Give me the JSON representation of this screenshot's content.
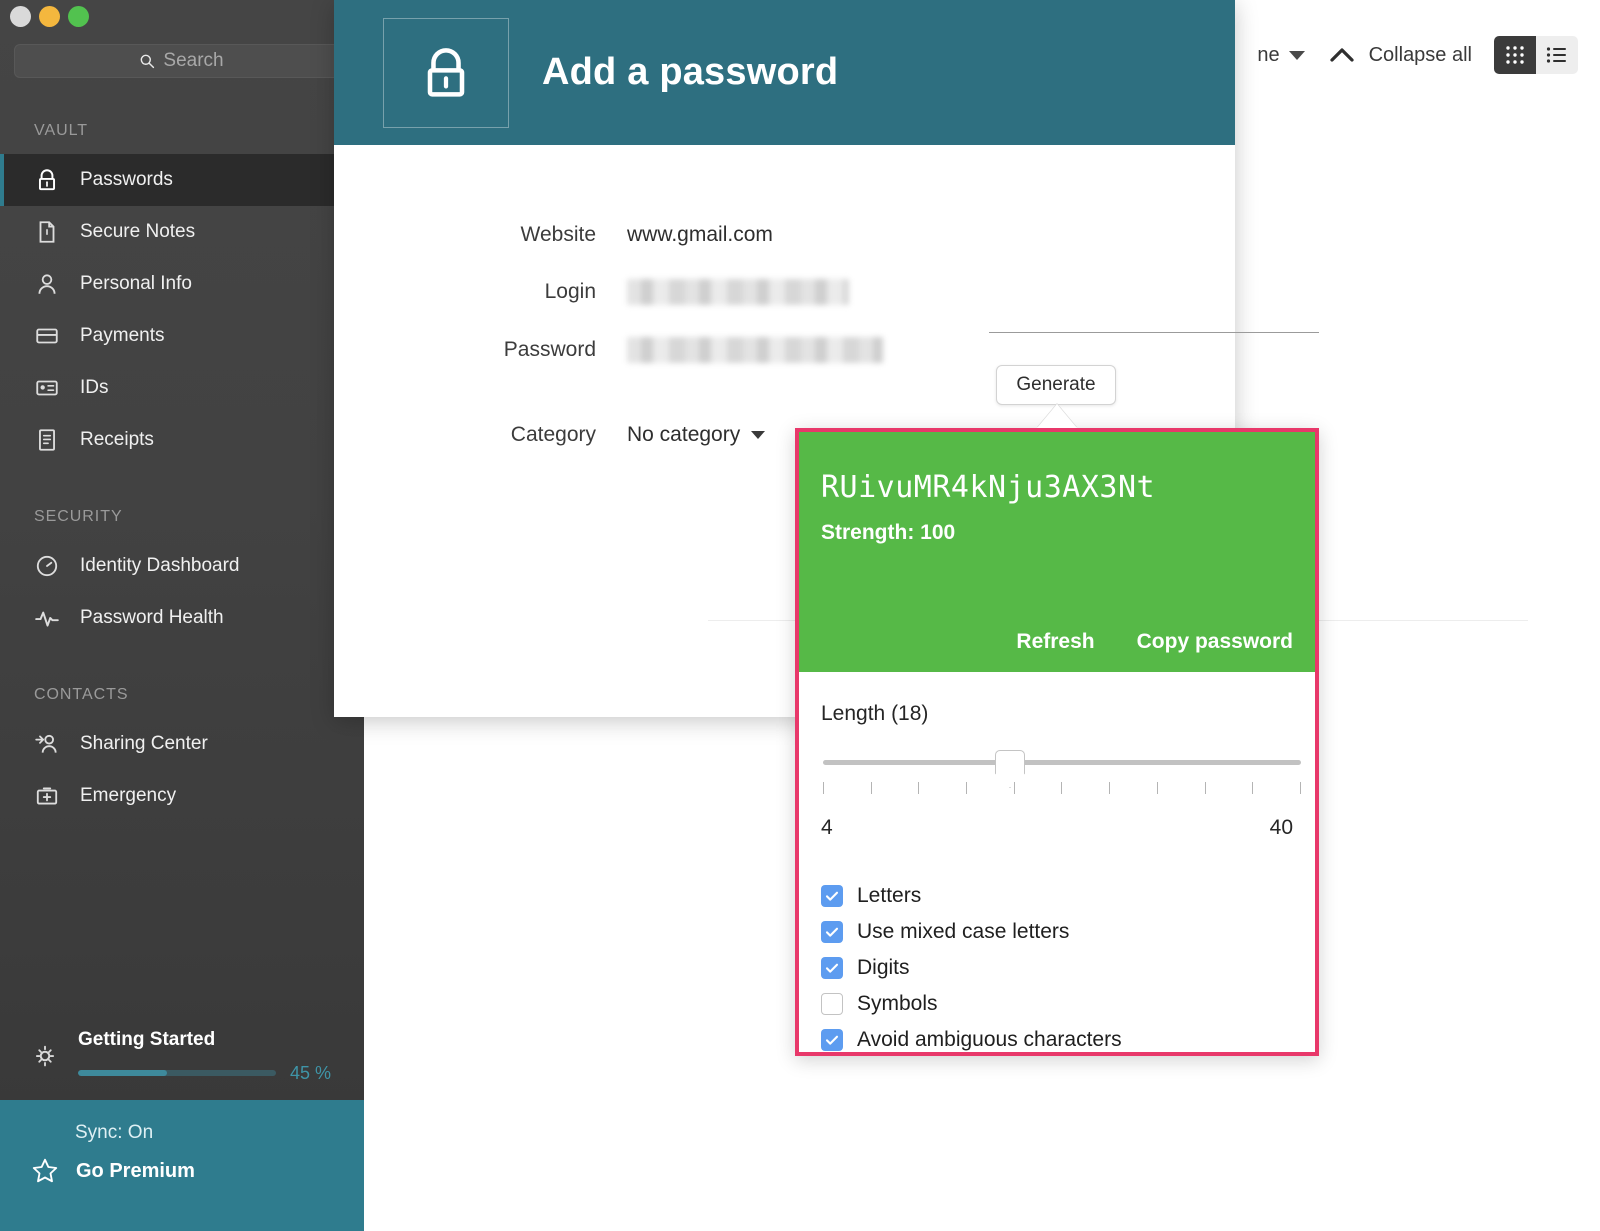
{
  "window": {
    "traffic_lights": [
      "close",
      "minimize",
      "zoom"
    ]
  },
  "search": {
    "placeholder": "Search",
    "icon": "search-icon"
  },
  "sidebar": {
    "sections": [
      {
        "title": "VAULT",
        "items": [
          {
            "label": "Passwords",
            "icon": "lock-icon",
            "active": true
          },
          {
            "label": "Secure Notes",
            "icon": "note-icon",
            "active": false
          },
          {
            "label": "Personal Info",
            "icon": "person-icon",
            "active": false
          },
          {
            "label": "Payments",
            "icon": "card-icon",
            "active": false
          },
          {
            "label": "IDs",
            "icon": "id-card-icon",
            "active": false
          },
          {
            "label": "Receipts",
            "icon": "receipt-icon",
            "active": false
          }
        ]
      },
      {
        "title": "SECURITY",
        "items": [
          {
            "label": "Identity Dashboard",
            "icon": "gauge-icon",
            "active": false
          },
          {
            "label": "Password Health",
            "icon": "pulse-icon",
            "active": false
          }
        ]
      },
      {
        "title": "CONTACTS",
        "items": [
          {
            "label": "Sharing Center",
            "icon": "share-person-icon",
            "active": false
          },
          {
            "label": "Emergency",
            "icon": "emergency-kit-icon",
            "active": false
          }
        ]
      }
    ],
    "getting_started": {
      "label": "Getting Started",
      "percent_label": "45 %",
      "percent_value": 45,
      "icon": "lightbulb-icon"
    },
    "footer": {
      "sync_label": "Sync: On",
      "premium_label": "Go Premium",
      "icon": "star-icon",
      "accent": "#2f7c8e"
    }
  },
  "toolbar": {
    "sort_label": "ne",
    "collapse_label": "Collapse all",
    "grid_view_icon": "grid-view-icon",
    "list_view_icon": "list-view-icon",
    "active_view": "grid"
  },
  "dialog": {
    "title": "Add a password",
    "header_icon": "lock-icon",
    "header_color": "#2e6f80",
    "fields": [
      {
        "label": "Website",
        "value": "www.gmail.com",
        "masked": false
      },
      {
        "label": "Login",
        "value": "",
        "masked": true
      },
      {
        "label": "Password",
        "value": "",
        "masked": true
      }
    ],
    "category": {
      "label": "Category",
      "value": "No category"
    },
    "generate_button": "Generate"
  },
  "generator": {
    "border_color": "#e8386a",
    "green_color": "#56b947",
    "password": "RUivuMR4kNju3AX3Nt",
    "strength_label": "Strength: 100",
    "refresh_label": "Refresh",
    "copy_label": "Copy password",
    "length_label": "Length (18)",
    "length_value": 18,
    "range_min_label": "4",
    "range_max_label": "40",
    "tick_count": 11,
    "options": [
      {
        "label": "Letters",
        "checked": true
      },
      {
        "label": "Use mixed case letters",
        "checked": true
      },
      {
        "label": "Digits",
        "checked": true
      },
      {
        "label": "Symbols",
        "checked": false
      },
      {
        "label": "Avoid ambiguous characters",
        "checked": true
      }
    ]
  }
}
